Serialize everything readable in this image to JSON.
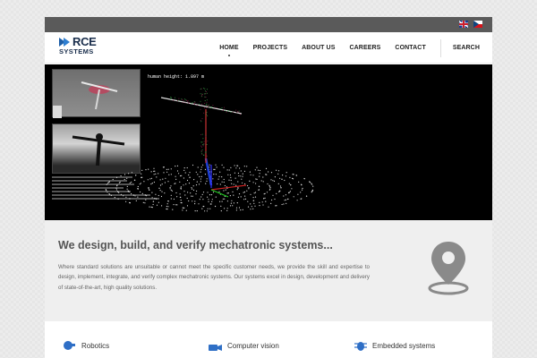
{
  "colors": {
    "topbar": "#5a5a5a",
    "hero_bg": "#000000",
    "intro_bg": "#efefef",
    "accent_blue": "#2f6fc6",
    "icon_gray": "#8a8a8a"
  },
  "topbar": {
    "languages": [
      {
        "icon": "uk-flag-icon",
        "label": "English"
      },
      {
        "icon": "cz-flag-icon",
        "label": "Czech"
      }
    ]
  },
  "header": {
    "logo": {
      "line1": "RCE",
      "line2": "SYSTEMS"
    },
    "nav": {
      "items": [
        {
          "label": "HOME",
          "active": true
        },
        {
          "label": "PROJECTS",
          "active": false
        },
        {
          "label": "ABOUT US",
          "active": false
        },
        {
          "label": "CAREERS",
          "active": false
        },
        {
          "label": "CONTACT",
          "active": false
        }
      ],
      "search_label": "SEARCH"
    }
  },
  "hero": {
    "readout": "human height: 1.897 m"
  },
  "intro": {
    "title": "We design, build, and verify mechatronic systems...",
    "text": "Where standard solutions are unsuitable or cannot meet the specific customer needs, we provide the skill and expertise to design, implement, integrate, and verify complex mechatronic systems. Our systems excel in design, development and delivery of state-of-the-art, high quality solutions.",
    "icon": "location-pin-icon"
  },
  "services": [
    {
      "label": "Robotics",
      "icon": "robot-arm-icon"
    },
    {
      "label": "Computer vision",
      "icon": "video-camera-icon"
    },
    {
      "label": "Embedded systems",
      "icon": "bug-chip-icon"
    }
  ]
}
